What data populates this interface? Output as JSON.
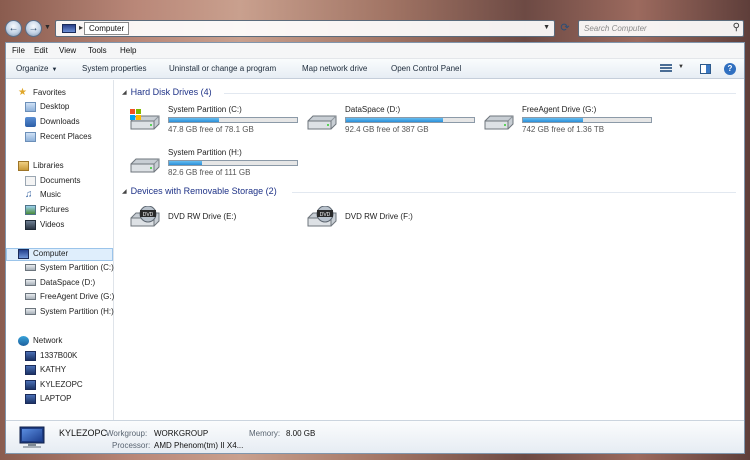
{
  "address": {
    "location": "Computer",
    "search_placeholder": "Search Computer"
  },
  "menu": {
    "file": "File",
    "edit": "Edit",
    "view": "View",
    "tools": "Tools",
    "help": "Help"
  },
  "toolbar": {
    "organize": "Organize",
    "system_properties": "System properties",
    "uninstall": "Uninstall or change a program",
    "map_drive": "Map network drive",
    "control_panel": "Open Control Panel"
  },
  "nav": {
    "favorites": "Favorites",
    "desktop": "Desktop",
    "downloads": "Downloads",
    "recent": "Recent Places",
    "libraries": "Libraries",
    "documents": "Documents",
    "music": "Music",
    "pictures": "Pictures",
    "videos": "Videos",
    "computer": "Computer",
    "drive_c": "System Partition (C:)",
    "drive_d": "DataSpace (D:)",
    "drive_g": "FreeAgent Drive (G:)",
    "drive_h": "System Partition (H:)",
    "network": "Network",
    "net_1": "1337B00K",
    "net_2": "KATHY",
    "net_3": "KYLEZOPC",
    "net_4": "LAPTOP"
  },
  "groups": {
    "hard_disks": "Hard Disk Drives (4)",
    "removable": "Devices with Removable Storage (2)"
  },
  "drives": [
    {
      "name": "System Partition (C:)",
      "free": "47.8 GB free of 78.1 GB",
      "used_fraction": 0.39
    },
    {
      "name": "DataSpace (D:)",
      "free": "92.4 GB free of 387 GB",
      "used_fraction": 0.76
    },
    {
      "name": "FreeAgent Drive (G:)",
      "free": "742 GB free of 1.36 TB",
      "used_fraction": 0.47
    },
    {
      "name": "System Partition (H:)",
      "free": "82.6 GB free of 111 GB",
      "used_fraction": 0.26
    }
  ],
  "dvd": [
    {
      "name": "DVD RW Drive (E:)"
    },
    {
      "name": "DVD RW Drive (F:)"
    }
  ],
  "details": {
    "computer_name": "KYLEZOPC",
    "workgroup_label": "Workgroup:",
    "workgroup": "WORKGROUP",
    "memory_label": "Memory:",
    "memory": "8.00 GB",
    "processor_label": "Processor:",
    "processor": "AMD Phenom(tm) II X4..."
  },
  "colors": {
    "bar_fill": "#2a8fd9",
    "group_header": "#1e3287",
    "selection": "#dfeefc"
  }
}
